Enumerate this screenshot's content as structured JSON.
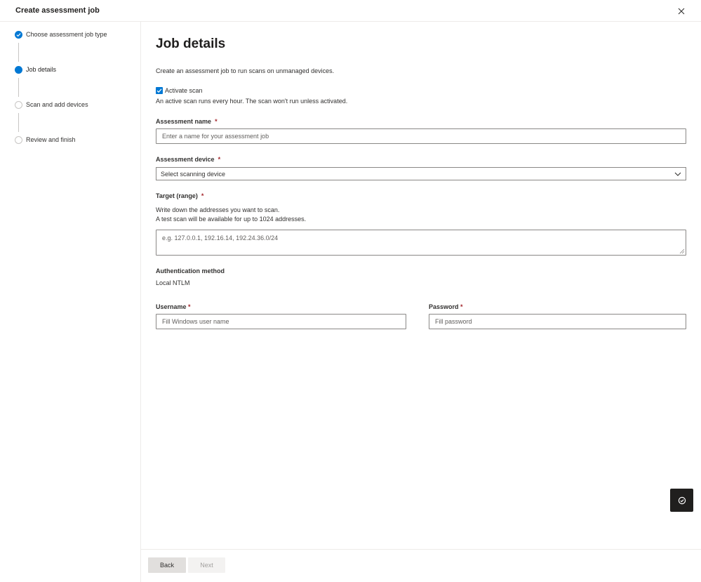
{
  "header": {
    "title": "Create assessment job"
  },
  "steps": [
    {
      "label": "Choose assessment job type",
      "state": "done"
    },
    {
      "label": "Job details",
      "state": "current"
    },
    {
      "label": "Scan and add devices",
      "state": "todo"
    },
    {
      "label": "Review and finish",
      "state": "todo"
    }
  ],
  "main": {
    "heading": "Job details",
    "intro": "Create an assessment job to run scans on unmanaged devices.",
    "activate": {
      "label": "Activate scan",
      "checked": true,
      "help": "An active scan runs every hour. The scan won't run unless activated."
    },
    "assessment_name": {
      "label": "Assessment name",
      "required": "*",
      "placeholder": "Enter a name for your assessment job"
    },
    "assessment_device": {
      "label": "Assessment device",
      "required": "*",
      "value": "Select scanning device"
    },
    "target": {
      "label": "Target (range)",
      "required": "*",
      "help_line1": "Write down the addresses you want to scan.",
      "help_line2": "A test scan will be available for up to 1024 addresses.",
      "placeholder": "e.g. 127.0.0.1, 192.16.14, 192.24.36.0/24"
    },
    "auth": {
      "label": "Authentication method",
      "value": "Local NTLM"
    },
    "username": {
      "label": "Username",
      "required": "*",
      "placeholder": "Fill Windows user name"
    },
    "password": {
      "label": "Password",
      "required": "*",
      "placeholder": "Fill password"
    }
  },
  "footer": {
    "back_label": "Back",
    "next_label": "Next"
  },
  "colors": {
    "accent": "#0078d4",
    "required": "#a4262c",
    "fab": "#201f1e"
  },
  "icons": {
    "close": "close-icon",
    "chevron": "chevron-down-icon",
    "check": "checkmark-icon",
    "fab": "feedback-icon"
  }
}
